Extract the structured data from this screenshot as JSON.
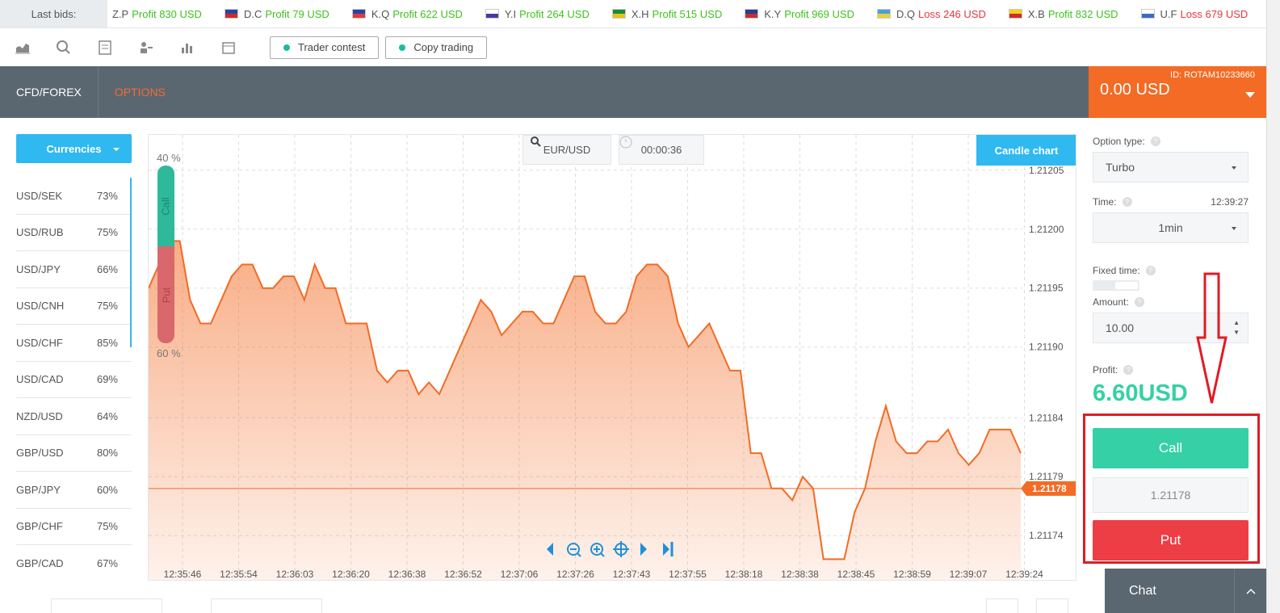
{
  "ticker": {
    "label": "Last bids:",
    "items": [
      {
        "name": "Z.P",
        "result": "Profit 830 USD",
        "type": "profit",
        "flag": [
          "#ffffff",
          "#ffffff"
        ]
      },
      {
        "name": "D.C",
        "result": "Profit 79 USD",
        "type": "profit",
        "flag": [
          "#2546a3",
          "#d42929"
        ]
      },
      {
        "name": "K.Q",
        "result": "Profit 622 USD",
        "type": "profit",
        "flag": [
          "#2246a8",
          "#e03a3a"
        ]
      },
      {
        "name": "Y.I",
        "result": "Profit 264 USD",
        "type": "profit",
        "flag": [
          "#ffffff",
          "#4a3aa0"
        ]
      },
      {
        "name": "X.H",
        "result": "Profit 515 USD",
        "type": "profit",
        "flag": [
          "#1a8a3a",
          "#e8c21a"
        ]
      },
      {
        "name": "K.Y",
        "result": "Profit 969 USD",
        "type": "profit",
        "flag": [
          "#2a3e8a",
          "#c43030"
        ]
      },
      {
        "name": "D.Q",
        "result": "Loss 246 USD",
        "type": "loss",
        "flag": [
          "#4aa0d8",
          "#e8d23a"
        ]
      },
      {
        "name": "X.B",
        "result": "Profit 832 USD",
        "type": "profit",
        "flag": [
          "#f2d21a",
          "#d42929"
        ]
      },
      {
        "name": "U.F",
        "result": "Loss 679 USD",
        "type": "loss",
        "flag": [
          "#ffffff",
          "#3a6ac8"
        ]
      }
    ]
  },
  "toolbar": {
    "icons": [
      "area-chart-icon",
      "search-chart-icon",
      "document-icon",
      "user-icon",
      "bar-chart-icon",
      "calendar-icon"
    ],
    "trader_contest": "Trader contest",
    "copy_trading": "Copy trading"
  },
  "nav": {
    "cfd": "CFD/FOREX",
    "options": "OPTIONS",
    "account_id": "ID: ROTAM10233660",
    "balance": "0.00 USD"
  },
  "sidebar": {
    "button": "Currencies",
    "pairs": [
      {
        "name": "USD/SEK",
        "pct": "73%"
      },
      {
        "name": "USD/RUB",
        "pct": "75%"
      },
      {
        "name": "USD/JPY",
        "pct": "66%"
      },
      {
        "name": "USD/CNH",
        "pct": "75%"
      },
      {
        "name": "USD/CHF",
        "pct": "85%"
      },
      {
        "name": "USD/CAD",
        "pct": "69%"
      },
      {
        "name": "NZD/USD",
        "pct": "64%"
      },
      {
        "name": "GBP/USD",
        "pct": "80%"
      },
      {
        "name": "GBP/JPY",
        "pct": "60%"
      },
      {
        "name": "GBP/CHF",
        "pct": "75%"
      },
      {
        "name": "GBP/CAD",
        "pct": "67%"
      }
    ]
  },
  "chart": {
    "pair": "EUR/USD",
    "timer": "00:00:36",
    "candle_btn": "Candle chart",
    "call_label": "Call",
    "put_label": "Put",
    "call_pct": "40 %",
    "put_pct": "60 %"
  },
  "chart_data": {
    "type": "area",
    "title": "",
    "xlabel": "",
    "ylabel": "",
    "x": [
      "12:35:46",
      "12:35:54",
      "12:36:03",
      "12:36:20",
      "12:36:38",
      "12:36:52",
      "12:37:06",
      "12:37:26",
      "12:37:43",
      "12:37:55",
      "12:38:18",
      "12:38:38",
      "12:38:45",
      "12:38:59",
      "12:39:07",
      "12:39:24"
    ],
    "y_ticks": [
      "1.21205",
      "1.21200",
      "1.21195",
      "1.21190",
      "1.21184",
      "1.21179",
      "1.21174"
    ],
    "current_price": "1.21178",
    "ylim": [
      1.21171,
      1.21208
    ],
    "series": [
      {
        "values": [
          1.21195,
          1.21197,
          1.21199,
          1.21199,
          1.21194,
          1.21192,
          1.21192,
          1.21194,
          1.21196,
          1.21197,
          1.21197,
          1.21195,
          1.21195,
          1.21196,
          1.21196,
          1.21194,
          1.21197,
          1.21195,
          1.21195,
          1.21192,
          1.21192,
          1.21192,
          1.21188,
          1.21187,
          1.21188,
          1.21188,
          1.21186,
          1.21187,
          1.21186,
          1.21188,
          1.2119,
          1.21192,
          1.21194,
          1.21193,
          1.21191,
          1.21192,
          1.21193,
          1.21193,
          1.21192,
          1.21192,
          1.21194,
          1.21196,
          1.21196,
          1.21193,
          1.21192,
          1.21192,
          1.21193,
          1.21196,
          1.21197,
          1.21197,
          1.21196,
          1.21192,
          1.2119,
          1.21191,
          1.21192,
          1.2119,
          1.21188,
          1.21188,
          1.21181,
          1.21181,
          1.21178,
          1.21178,
          1.21177,
          1.21179,
          1.21178,
          1.21172,
          1.21172,
          1.21172,
          1.21176,
          1.21178,
          1.21182,
          1.21185,
          1.21182,
          1.21181,
          1.21181,
          1.21182,
          1.21182,
          1.21183,
          1.21181,
          1.2118,
          1.21181,
          1.21183,
          1.21183,
          1.21183,
          1.21181
        ]
      }
    ],
    "color": "#f36b24",
    "grid": true
  },
  "controls": {
    "option_type_label": "Option type:",
    "option_type_value": "Turbo",
    "time_label": "Time:",
    "time_clock": "12:39:27",
    "time_value": "1min",
    "fixed_time_label": "Fixed time:",
    "amount_label": "Amount:",
    "amount_value": "10.00",
    "profit_label": "Profit:",
    "profit_value": "6.60USD",
    "call": "Call",
    "price": "1.21178",
    "put": "Put"
  },
  "chat": {
    "label": "Chat"
  },
  "colors": {
    "accent": "#2fb9f0",
    "orange": "#f36b24",
    "call": "#35d0a6",
    "put": "#ed3e46",
    "annotation": "#e21b23"
  }
}
